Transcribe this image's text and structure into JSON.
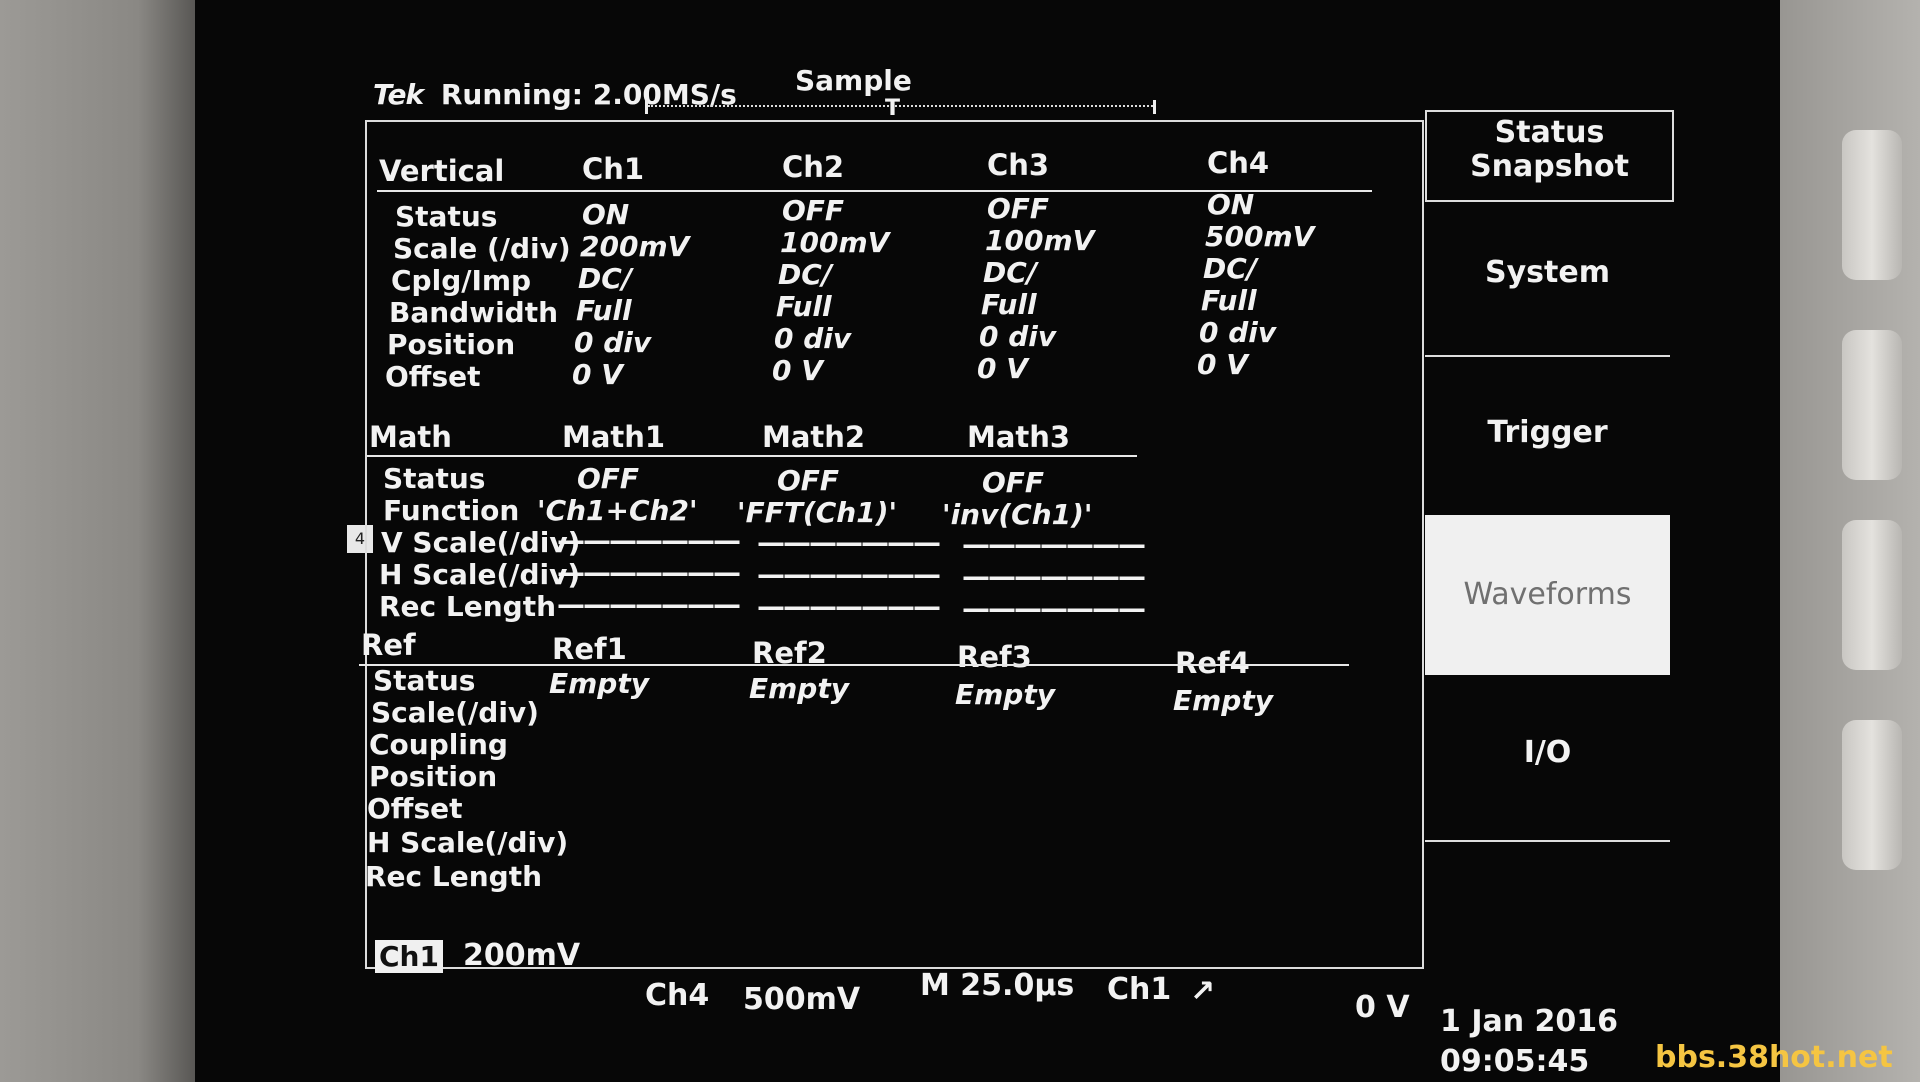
{
  "header": {
    "brand": "Tek",
    "status": "Running: 2.00MS/s",
    "mode": "Sample",
    "trigger_marker": "T"
  },
  "vertical": {
    "title": "Vertical",
    "channels": [
      "Ch1",
      "Ch2",
      "Ch3",
      "Ch4"
    ],
    "rows": [
      {
        "label": "Status",
        "values": [
          "ON",
          "OFF",
          "OFF",
          "ON"
        ]
      },
      {
        "label": "Scale (/div)",
        "values": [
          "200mV",
          "100mV",
          "100mV",
          "500mV"
        ]
      },
      {
        "label": "Cplg/Imp",
        "values": [
          "DC/",
          "DC/",
          "DC/",
          "DC/"
        ]
      },
      {
        "label": "Bandwidth",
        "values": [
          "Full",
          "Full",
          "Full",
          "Full"
        ]
      },
      {
        "label": "Position",
        "values": [
          "0 div",
          "0 div",
          "0 div",
          "0 div"
        ]
      },
      {
        "label": "Offset",
        "values": [
          "0 V",
          "0 V",
          "0 V",
          "0 V"
        ]
      }
    ]
  },
  "math": {
    "title": "Math",
    "channels": [
      "Math1",
      "Math2",
      "Math3"
    ],
    "rows": [
      {
        "label": "Status",
        "values": [
          "OFF",
          "OFF",
          "OFF"
        ]
      },
      {
        "label": "Function",
        "values": [
          "'Ch1+Ch2'",
          "'FFT(Ch1)'",
          "'inv(Ch1)'"
        ]
      },
      {
        "label": "V Scale(/div)",
        "values": [
          "———————",
          "———————",
          "———————"
        ]
      },
      {
        "label": "H Scale(/div)",
        "values": [
          "———————",
          "———————",
          "———————"
        ]
      },
      {
        "label": "Rec Length",
        "values": [
          "———————",
          "———————",
          "———————"
        ]
      }
    ]
  },
  "ref": {
    "title": "Ref",
    "channels": [
      "Ref1",
      "Ref2",
      "Ref3",
      "Ref4"
    ],
    "status_values": [
      "Empty",
      "Empty",
      "Empty",
      "Empty"
    ],
    "labels": [
      "Status",
      "Scale(/div)",
      "Coupling",
      "Position",
      "Offset",
      "H Scale(/div)",
      "Rec Length"
    ]
  },
  "menu": {
    "title_line1": "Status",
    "title_line2": "Snapshot",
    "items": [
      "System",
      "Trigger",
      "Waveforms",
      "I/O"
    ],
    "selected": "Waveforms"
  },
  "footer": {
    "ch1_label": "Ch1",
    "ch1_scale": "200mV",
    "ch4_label": "Ch4",
    "ch4_scale": "500mV",
    "timebase": "M 25.0µs",
    "trigger_source": "Ch1",
    "trigger_slope": "↗",
    "trigger_level": "0 V",
    "date": "1 Jan 2016",
    "time": "09:05:45"
  },
  "left_marker": "4",
  "watermark": "bbs.38hot.net"
}
